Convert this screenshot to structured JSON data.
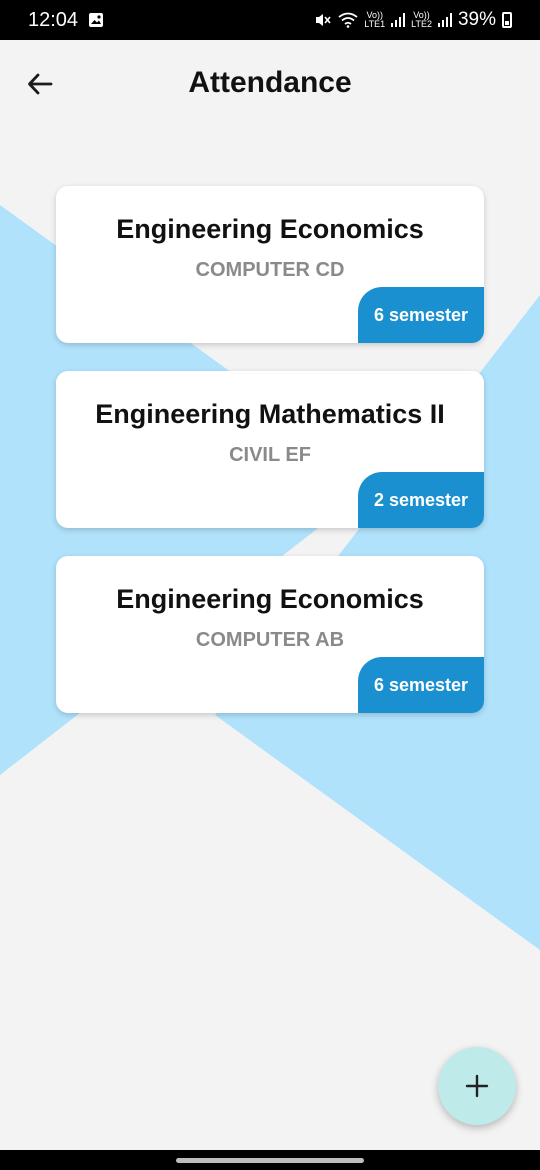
{
  "status": {
    "time": "12:04",
    "battery": "39%",
    "sim1": "LTE1",
    "sim2": "LTE2",
    "volte": "Vo))"
  },
  "header": {
    "title": "Attendance"
  },
  "courses": [
    {
      "subject": "Engineering Economics",
      "group": "COMPUTER CD",
      "semester": "6 semester"
    },
    {
      "subject": "Engineering Mathematics II",
      "group": "CIVIL EF",
      "semester": "2 semester"
    },
    {
      "subject": "Engineering Economics",
      "group": "COMPUTER AB",
      "semester": "6 semester"
    }
  ],
  "colors": {
    "accent": "#1a90d0",
    "background_shape": "#b0e2fc",
    "fab": "#bfeaea"
  }
}
